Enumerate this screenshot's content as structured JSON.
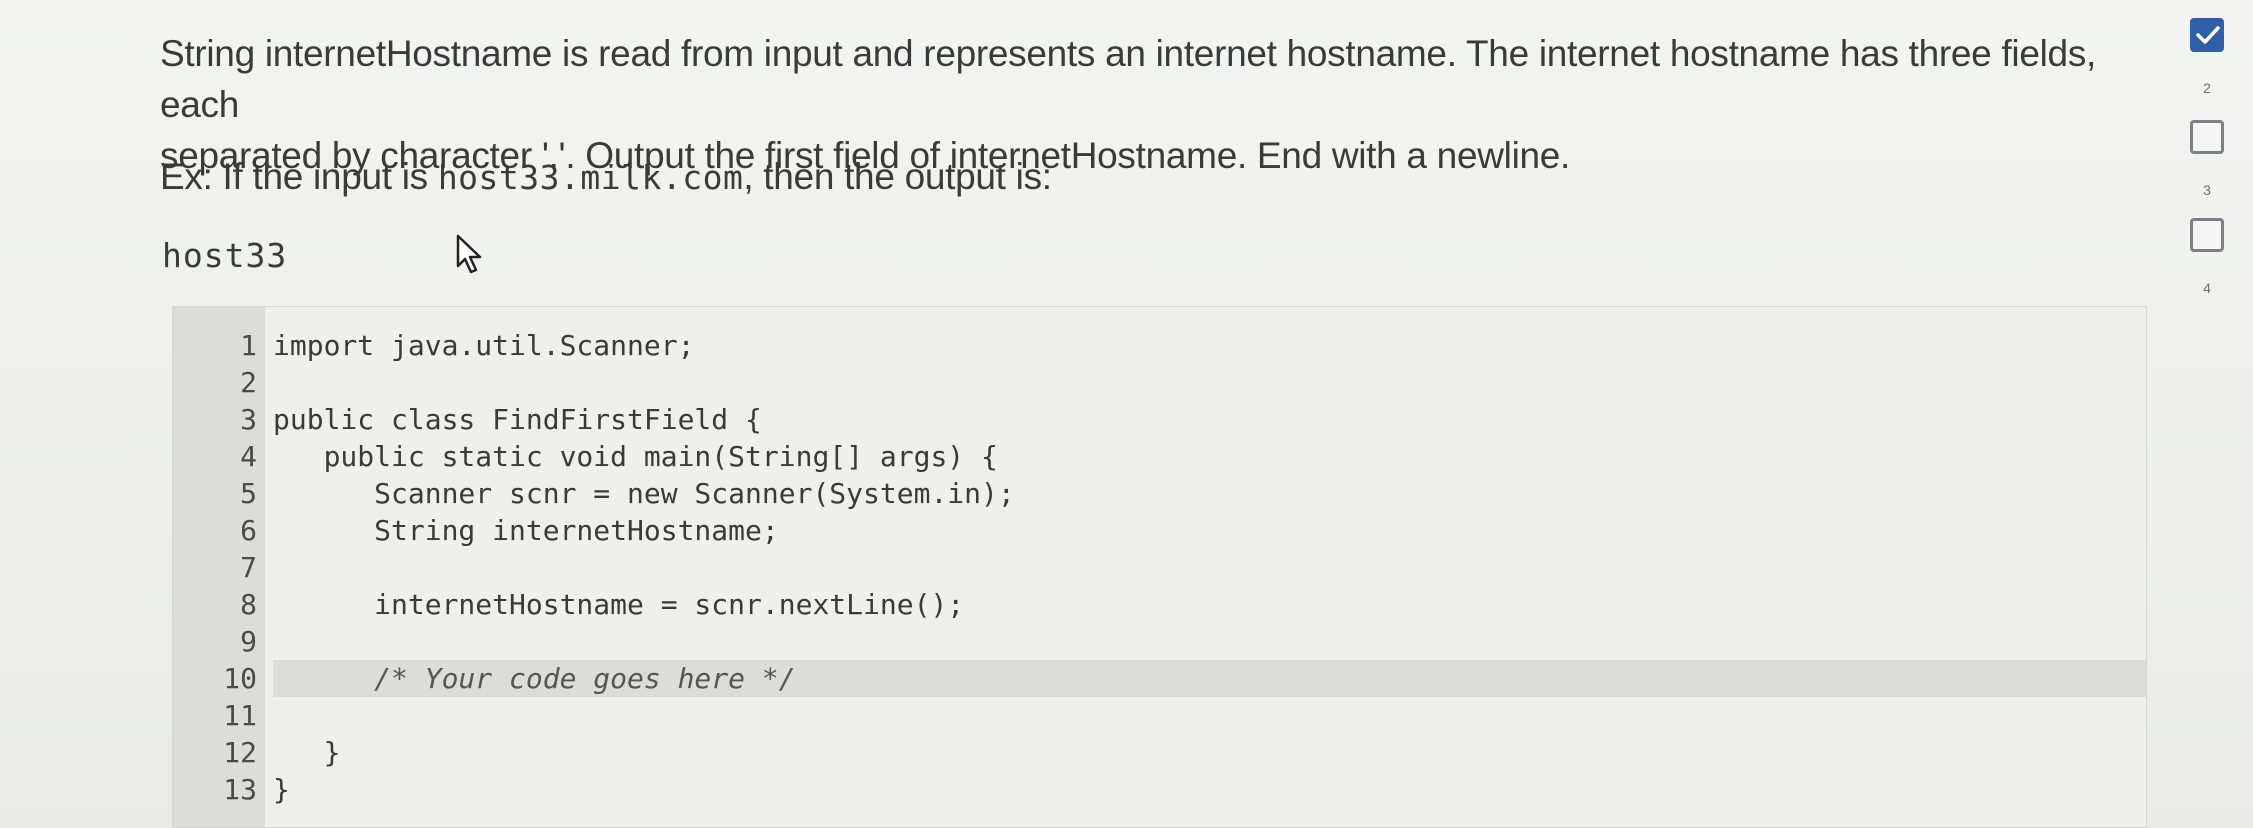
{
  "prompt": {
    "line1": "String internetHostname is read from input and represents an internet hostname. The internet hostname has three fields, each",
    "line2": "separated by character '.'. Output the first field of internetHostname. End with a newline."
  },
  "example": {
    "prefix": "Ex: If the input is ",
    "input": "host33.milk.com",
    "suffix": ", then the output is:",
    "output": "host33"
  },
  "editor": {
    "lines": [
      {
        "num": "1",
        "code": "import java.util.Scanner;"
      },
      {
        "num": "2",
        "code": ""
      },
      {
        "num": "3",
        "code": "public class FindFirstField {"
      },
      {
        "num": "4",
        "code": "   public static void main(String[] args) {"
      },
      {
        "num": "5",
        "code": "      Scanner scnr = new Scanner(System.in);"
      },
      {
        "num": "6",
        "code": "      String internetHostname;"
      },
      {
        "num": "7",
        "code": ""
      },
      {
        "num": "8",
        "code": "      internetHostname = scnr.nextLine();"
      },
      {
        "num": "9",
        "code": ""
      },
      {
        "num": "10",
        "code": "      /* Your code goes here */"
      },
      {
        "num": "11",
        "code": ""
      },
      {
        "num": "12",
        "code": "   }"
      },
      {
        "num": "13",
        "code": "}"
      }
    ],
    "active_line": "10"
  },
  "progress": {
    "items": [
      {
        "label": "2",
        "checked": true
      },
      {
        "label": "3",
        "checked": false
      },
      {
        "label": "4",
        "checked": false
      }
    ]
  },
  "colors": {
    "check_blue": "#2f5fa8",
    "gutter": "#dcdcd8"
  }
}
